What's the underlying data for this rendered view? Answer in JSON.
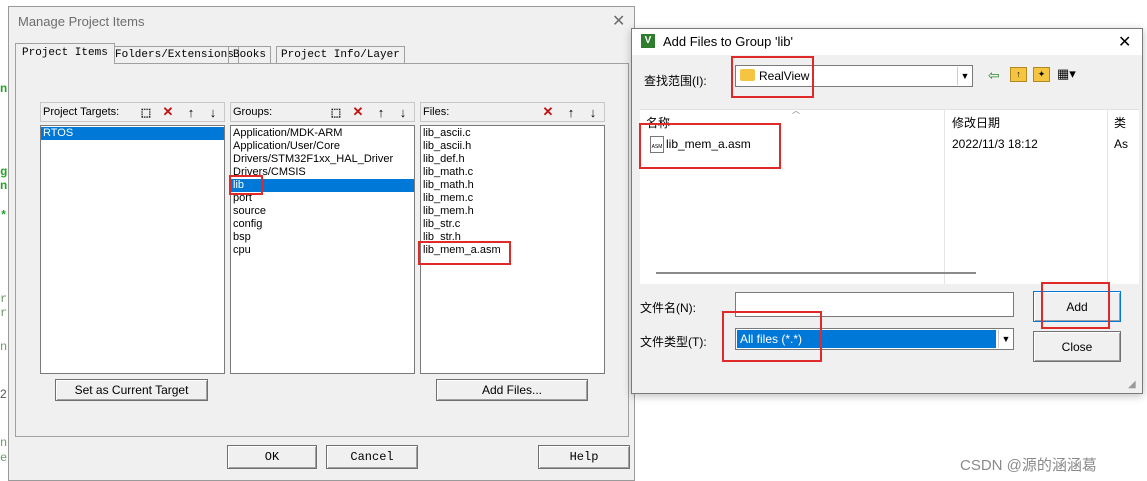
{
  "background_code": {
    "chars": [
      "n",
      "g",
      "n",
      "*",
      "r",
      "r",
      "n",
      "2",
      "n",
      "e"
    ]
  },
  "manage": {
    "title": "Manage Project Items",
    "tabs": [
      "Project Items",
      "Folders/Extensions",
      "Books",
      "Project Info/Layer"
    ],
    "targets_label": "Project Targets:",
    "groups_label": "Groups:",
    "files_label": "Files:",
    "targets": [
      "RTOS"
    ],
    "groups": [
      "Application/MDK-ARM",
      "Application/User/Core",
      "Drivers/STM32F1xx_HAL_Driver",
      "Drivers/CMSIS",
      "lib",
      "port",
      "source",
      "config",
      "bsp",
      "cpu"
    ],
    "files": [
      "lib_ascii.c",
      "lib_ascii.h",
      "lib_def.h",
      "lib_math.c",
      "lib_math.h",
      "lib_mem.c",
      "lib_mem.h",
      "lib_str.c",
      "lib_str.h",
      "lib_mem_a.asm"
    ],
    "set_target_button": "Set as Current Target",
    "add_files_button": "Add Files...",
    "ok_button": "OK",
    "cancel_button": "Cancel",
    "help_button": "Help"
  },
  "addfiles": {
    "title": "Add Files to Group 'lib'",
    "lookin_label": "查找范围(I):",
    "lookin_value": "RealView",
    "col_name": "名称",
    "col_date": "修改日期",
    "col_type": "类",
    "file_name": "lib_mem_a.asm",
    "file_date": "2022/11/3 18:12",
    "file_type": "As",
    "filename_label": "文件名(N):",
    "filename_value": "",
    "filetype_label": "文件类型(T):",
    "filetype_value": "All files (*.*)",
    "add_button": "Add",
    "close_button": "Close"
  },
  "watermark": "CSDN @源的涵涵葛",
  "colors": {
    "selection": "#0078d7",
    "highlight_box": "#e02a2a",
    "code_green": "#2aa02a"
  }
}
